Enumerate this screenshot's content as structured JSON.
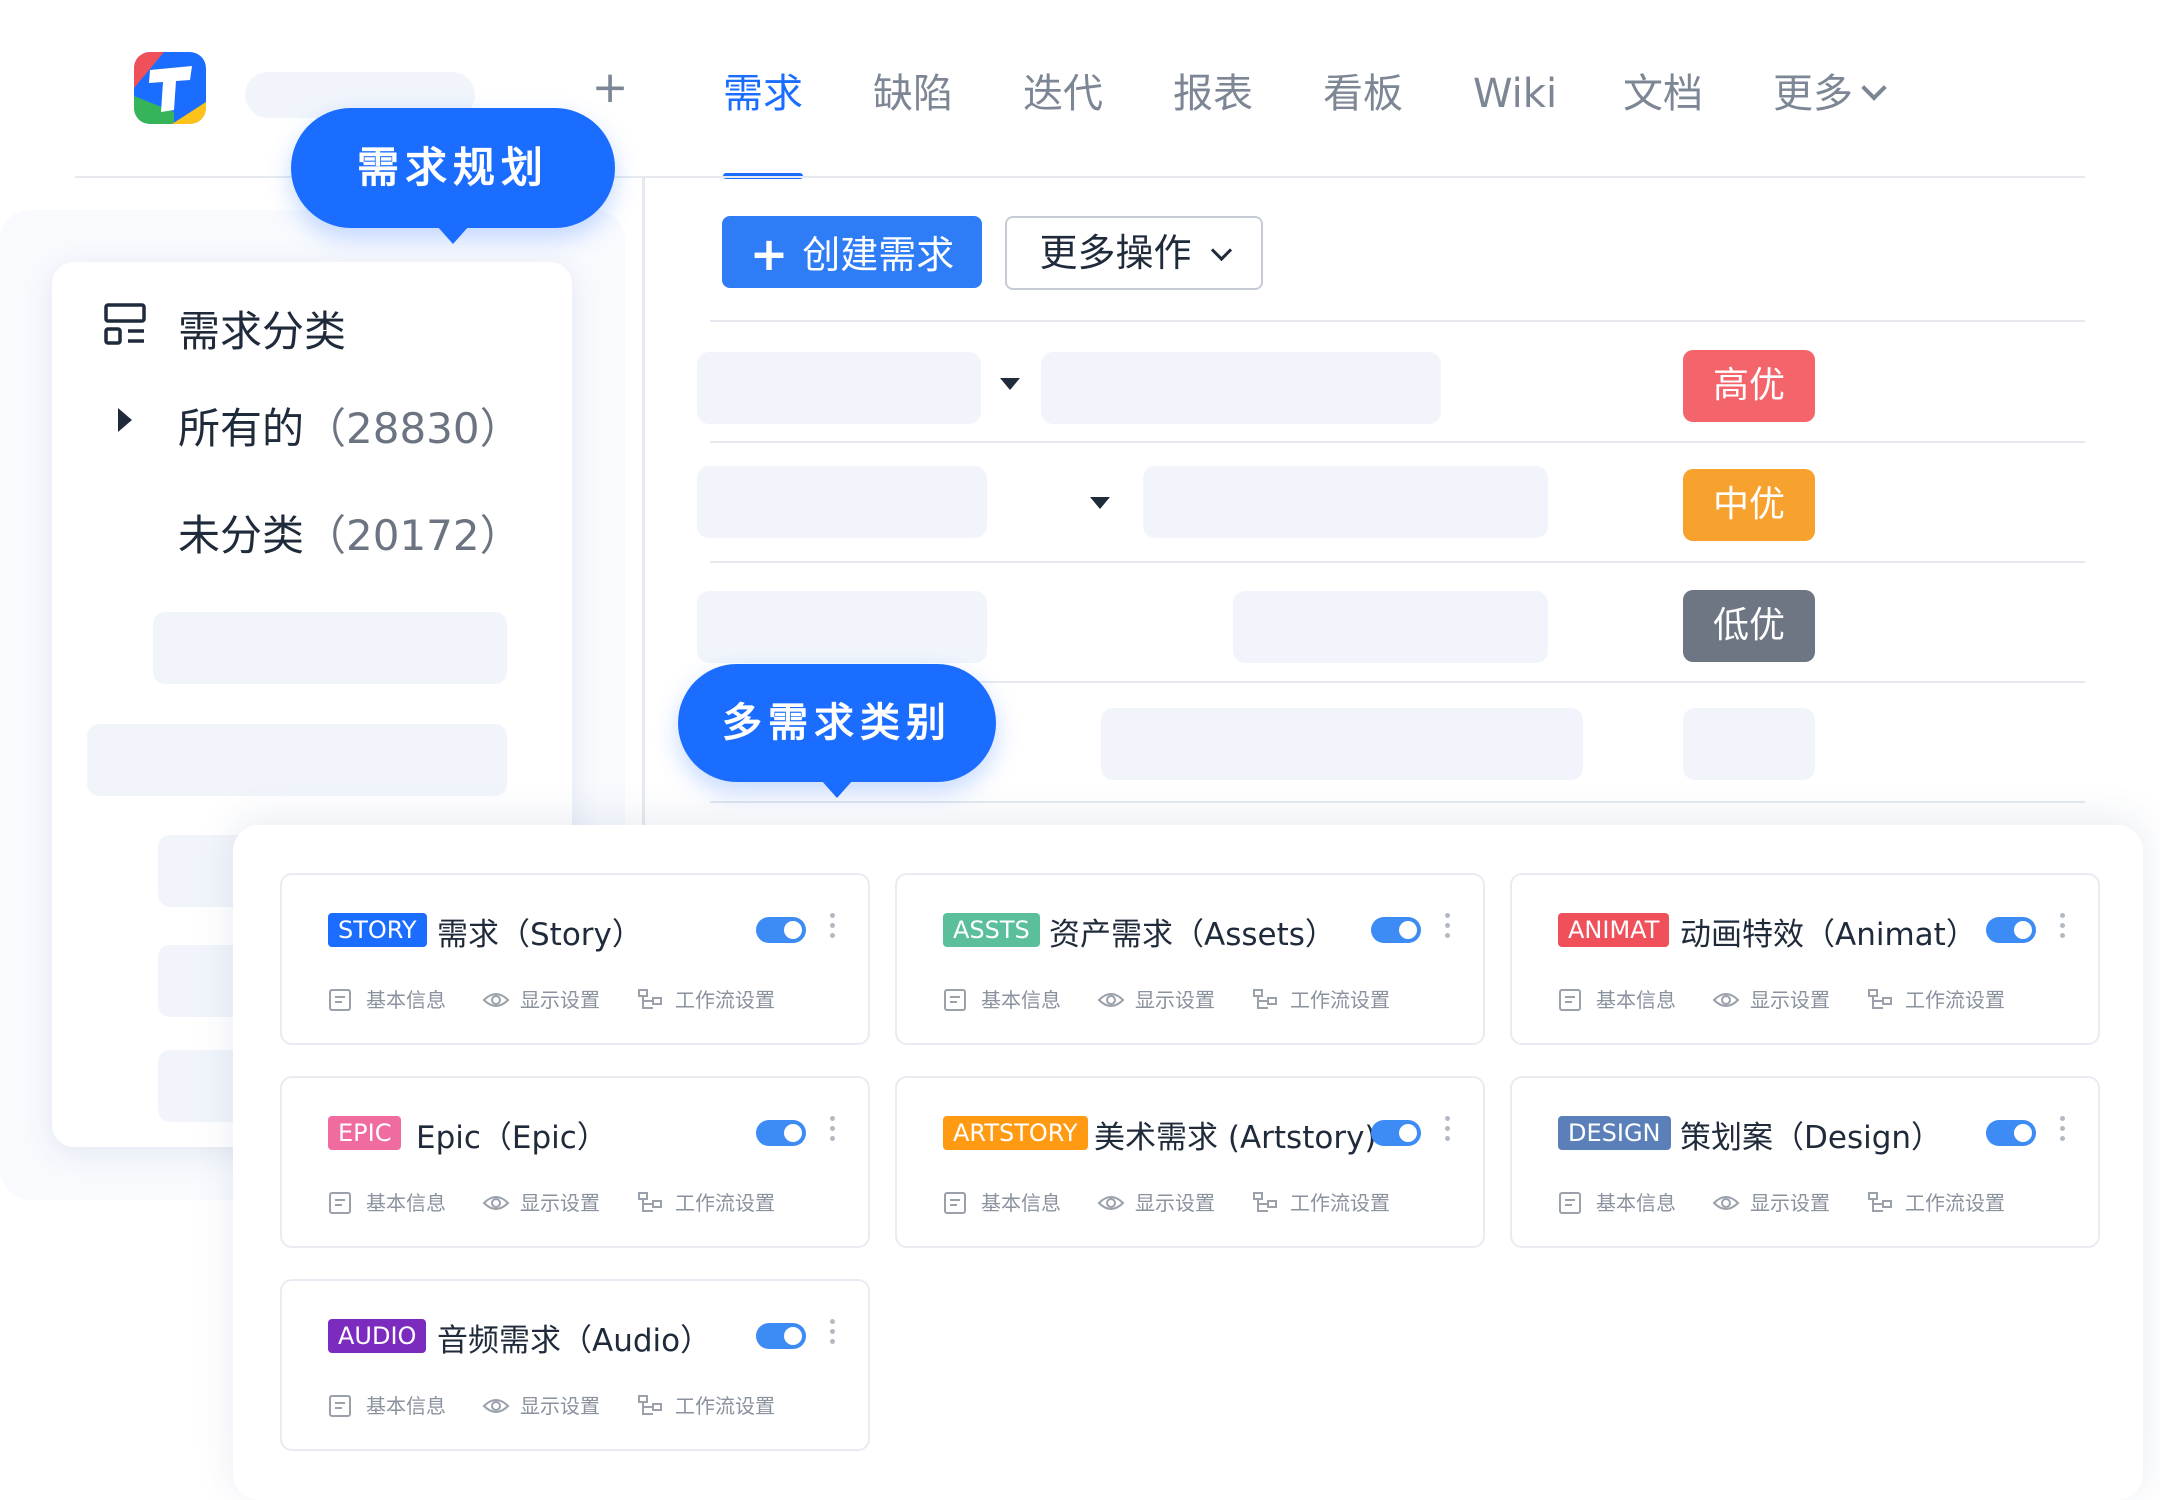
{
  "nav": {
    "tabs": [
      {
        "label": "需求"
      },
      {
        "label": "缺陷"
      },
      {
        "label": "迭代"
      },
      {
        "label": "报表"
      },
      {
        "label": "看板"
      },
      {
        "label": "Wiki"
      },
      {
        "label": "文档"
      },
      {
        "label": "更多"
      }
    ],
    "add_label": "+",
    "active_index": 0
  },
  "tooltips": {
    "planning": "需求规划",
    "multi_category": "多需求类别"
  },
  "sidebar": {
    "title": "需求分类",
    "items": [
      {
        "label": "所有的",
        "count": "（28830）"
      },
      {
        "label": "未分类",
        "count": "（20172）"
      }
    ]
  },
  "toolbar": {
    "create_icon": "+",
    "create_label": "创建需求",
    "more_label": "更多操作"
  },
  "priority": {
    "high": "高优",
    "mid": "中优",
    "low": "低优",
    "colors": {
      "high": "#f4656b",
      "mid": "#f7a22f",
      "low": "#6e7683"
    }
  },
  "categories": [
    {
      "tag": "STORY",
      "name": "需求（Story）",
      "color": "#1a6dff",
      "enabled": true
    },
    {
      "tag": "ASSTS",
      "name": "资产需求（Assets）",
      "color": "#5bbf9c",
      "enabled": true
    },
    {
      "tag": "ANIMAT",
      "name": "动画特效（Animat）",
      "color": "#f0505a",
      "enabled": true
    },
    {
      "tag": "EPIC",
      "name": "Epic（Epic）",
      "color": "#f06ca0",
      "enabled": true
    },
    {
      "tag": "ARTSTORY",
      "name": "美术需求 (Artstory)",
      "color": "#ff9a12",
      "enabled": true
    },
    {
      "tag": "DESIGN",
      "name": "策划案（Design）",
      "color": "#5b7fb8",
      "enabled": true
    },
    {
      "tag": "AUDIO",
      "name": "音频需求（Audio）",
      "color": "#7b2cbf",
      "enabled": true
    }
  ],
  "card_actions": {
    "basic": "基本信息",
    "display": "显示设置",
    "workflow": "工作流设置"
  }
}
